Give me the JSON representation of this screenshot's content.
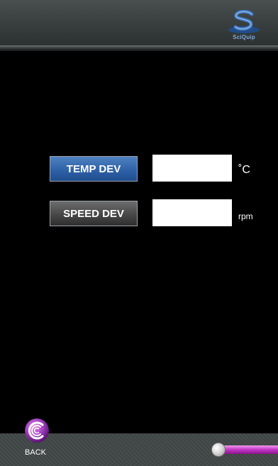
{
  "header": {
    "logo_text": "SciQuip",
    "logo_icon": "sciquip-logo-icon"
  },
  "controls": {
    "temp": {
      "button_label": "TEMP DEV",
      "value": "",
      "unit": "˚C"
    },
    "speed": {
      "button_label": "SPEED DEV",
      "value": "",
      "unit": "rpm"
    }
  },
  "footer": {
    "back_label": "BACK",
    "back_icon": "back-swirl-icon",
    "slider": {
      "level": 0
    }
  },
  "colors": {
    "background": "#000000",
    "temp_button": "#2f62a8",
    "speed_button": "#474747",
    "accent_purple": "#c335c3",
    "logo_blue": "#3f76bf"
  }
}
